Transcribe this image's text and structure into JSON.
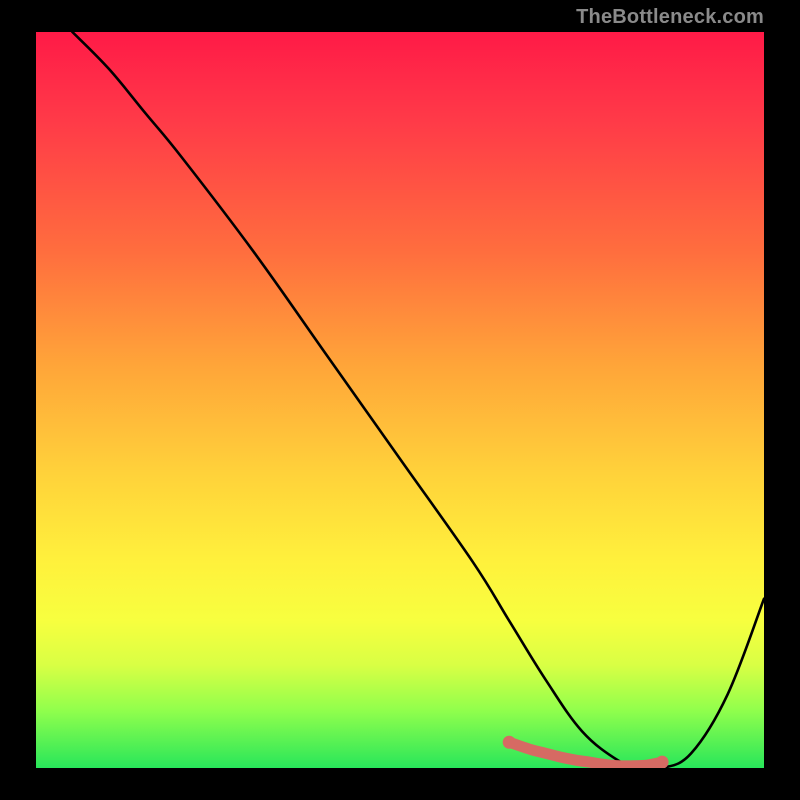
{
  "watermark": {
    "text": "TheBottleneck.com"
  },
  "chart_data": {
    "type": "line",
    "title": "",
    "xlabel": "",
    "ylabel": "",
    "xlim": [
      0,
      100
    ],
    "ylim": [
      0,
      100
    ],
    "grid": false,
    "background_gradient": {
      "stops": [
        {
          "pos": 0,
          "color": "#ff1a47"
        },
        {
          "pos": 12,
          "color": "#ff3a48"
        },
        {
          "pos": 30,
          "color": "#ff6e3e"
        },
        {
          "pos": 45,
          "color": "#ffa439"
        },
        {
          "pos": 60,
          "color": "#ffd23a"
        },
        {
          "pos": 72,
          "color": "#fff13c"
        },
        {
          "pos": 80,
          "color": "#f7ff3f"
        },
        {
          "pos": 86,
          "color": "#d9ff44"
        },
        {
          "pos": 92,
          "color": "#93ff4c"
        },
        {
          "pos": 100,
          "color": "#28e65a"
        }
      ]
    },
    "series": [
      {
        "name": "bottleneck-curve",
        "color": "#000000",
        "x": [
          5,
          10,
          15,
          20,
          30,
          40,
          50,
          60,
          65,
          70,
          75,
          80,
          83,
          86,
          90,
          95,
          100
        ],
        "y": [
          100,
          95,
          89,
          83,
          70,
          56,
          42,
          28,
          20,
          12,
          5,
          1,
          0,
          0,
          2,
          10,
          23
        ]
      }
    ],
    "valley_marker": {
      "color": "#d66a63",
      "x": [
        65,
        68,
        70,
        72,
        74,
        76,
        78,
        80,
        82,
        84,
        86
      ],
      "y": [
        3.5,
        2.5,
        2.0,
        1.5,
        1.1,
        0.8,
        0.5,
        0.3,
        0.3,
        0.4,
        0.8
      ]
    }
  }
}
